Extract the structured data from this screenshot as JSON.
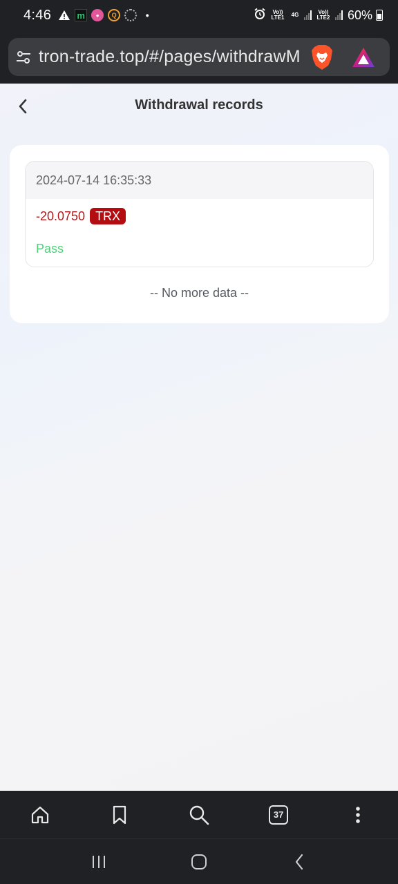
{
  "status_bar": {
    "time": "4:46",
    "sim1_label": "Vo)) LTE1",
    "sim2_label": "Vo)) LTE2",
    "network": "4G",
    "battery": "60%",
    "notification_icons": [
      "warning-icon",
      "m-app-icon",
      "pink-app-icon",
      "orange-app-icon",
      "ring-app-icon"
    ],
    "alarm_icon": "alarm-icon"
  },
  "browser": {
    "url": "tron-trade.top/#/pages/withdrawM",
    "shield_icon": "brave-lion-icon",
    "rewards_icon": "brave-rewards-icon"
  },
  "page": {
    "title": "Withdrawal records",
    "records": [
      {
        "datetime": "2024-07-14 16:35:33",
        "amount": "-20.0750",
        "currency": "TRX",
        "status": "Pass"
      }
    ],
    "no_more_text": "-- No more data --"
  },
  "toolbar": {
    "tab_count": "37"
  },
  "colors": {
    "amount": "#b0191a",
    "badge": "#b30d12",
    "status_pass": "#4cd37a",
    "chrome_dark": "#202124"
  }
}
